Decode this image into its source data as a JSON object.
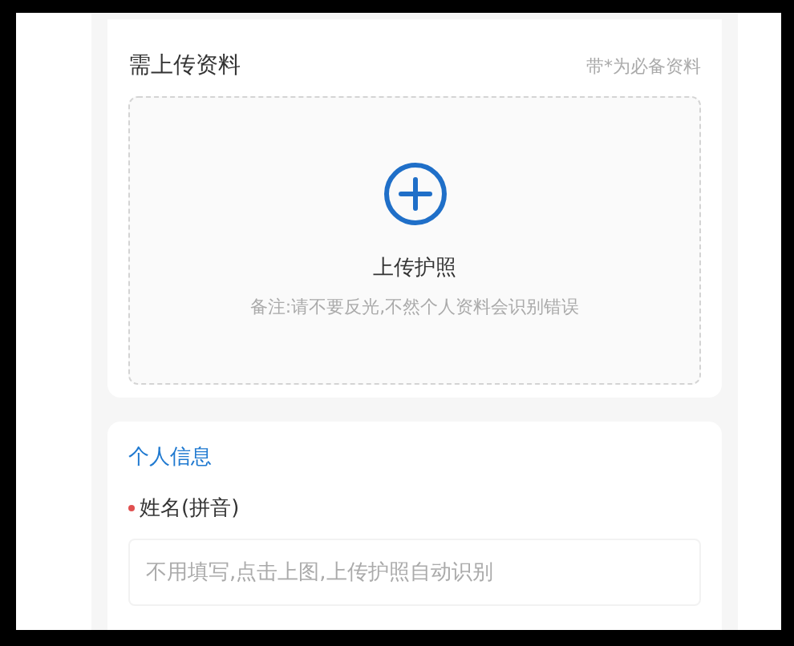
{
  "upload_section": {
    "title": "需上传资料",
    "hint": "带*为必备资料",
    "upload_box": {
      "label": "上传护照",
      "note": "备注:请不要反光,不然个人资料会识别错误"
    }
  },
  "personal_info": {
    "title": "个人信息",
    "fields": [
      {
        "label": "姓名(拼音)",
        "required": true,
        "placeholder": "不用填写,点击上图,上传护照自动识别"
      }
    ]
  }
}
